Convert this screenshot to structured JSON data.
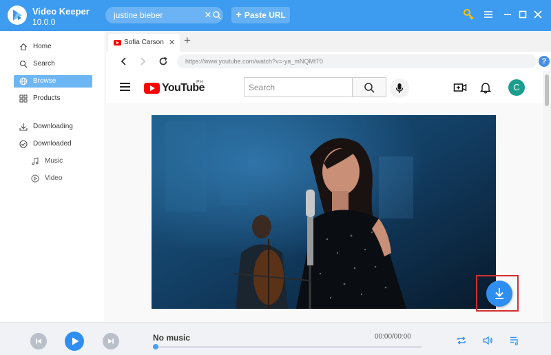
{
  "app": {
    "name": "Video Keeper",
    "version": "10.0.0",
    "brand_color": "#3d9bf0"
  },
  "titlebar": {
    "search_value": "justine bieber",
    "paste_label": "Paste URL",
    "icons": [
      "key-icon",
      "menu-icon",
      "minimize-icon",
      "maximize-icon",
      "close-icon"
    ]
  },
  "sidebar": {
    "items": [
      {
        "label": "Home",
        "icon": "home-icon"
      },
      {
        "label": "Search",
        "icon": "search-icon"
      },
      {
        "label": "Browse",
        "icon": "browse-icon",
        "active": true
      },
      {
        "label": "Products",
        "icon": "products-icon"
      },
      {
        "label": "Downloading",
        "icon": "download-icon"
      },
      {
        "label": "Downloaded",
        "icon": "check-circle-icon"
      },
      {
        "label": "Music",
        "icon": "music-note-icon"
      },
      {
        "label": "Video",
        "icon": "play-circle-icon"
      }
    ]
  },
  "browser": {
    "tab_title": "Sofia Carson -",
    "url": "https://www.youtube.com/watch?v=-ya_mNQMtT0"
  },
  "youtube": {
    "logo_text": "YouTube",
    "region": "PH",
    "search_placeholder": "Search",
    "avatar_letter": "C",
    "accent": "#ff0000"
  },
  "player": {
    "track": "No music",
    "time": "00:00/00:00",
    "progress": 0.01
  }
}
